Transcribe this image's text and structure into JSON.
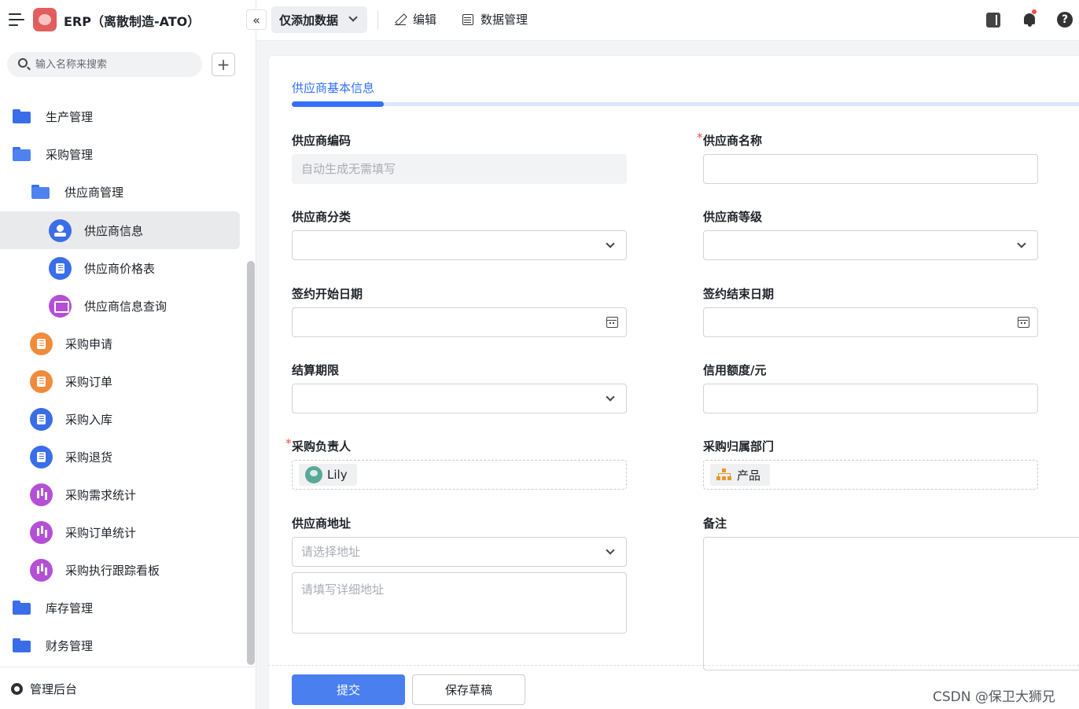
{
  "app": {
    "title": "ERP（离散制造-ATO）"
  },
  "search": {
    "placeholder": "输入名称来搜索"
  },
  "sidebar": {
    "items": [
      {
        "label": "生产管理",
        "icon": "folder-icon",
        "level": 0
      },
      {
        "label": "采购管理",
        "icon": "folder-open-icon",
        "level": 0
      },
      {
        "label": "供应商管理",
        "icon": "folder-open-icon",
        "level": 1
      },
      {
        "label": "供应商信息",
        "icon": "person-badge-icon",
        "color": "#3a6ee8",
        "level": 2,
        "active": true
      },
      {
        "label": "供应商价格表",
        "icon": "clipboard-icon",
        "color": "#3a6ee8",
        "level": 2
      },
      {
        "label": "供应商信息查询",
        "icon": "screen-chart-icon",
        "color": "#b44fd6",
        "level": 2
      },
      {
        "label": "采购申请",
        "icon": "document-icon",
        "color": "#f08b3c",
        "level": 1
      },
      {
        "label": "采购订单",
        "icon": "document-icon",
        "color": "#f08b3c",
        "level": 1
      },
      {
        "label": "采购入库",
        "icon": "document-icon",
        "color": "#3a6ee8",
        "level": 1
      },
      {
        "label": "采购退货",
        "icon": "document-icon",
        "color": "#3a6ee8",
        "level": 1
      },
      {
        "label": "采购需求统计",
        "icon": "bar-chart-icon",
        "color": "#b44fd6",
        "level": 1
      },
      {
        "label": "采购订单统计",
        "icon": "bar-chart-icon",
        "color": "#b44fd6",
        "level": 1
      },
      {
        "label": "采购执行跟踪看板",
        "icon": "bar-chart-icon",
        "color": "#b44fd6",
        "level": 1
      },
      {
        "label": "库存管理",
        "icon": "folder-icon",
        "level": 0
      },
      {
        "label": "财务管理",
        "icon": "folder-icon",
        "level": 0
      }
    ],
    "admin_label": "管理后台"
  },
  "toolbar": {
    "mode_label": "仅添加数据",
    "edit_label": "编辑",
    "data_manage_label": "数据管理"
  },
  "form": {
    "section_title": "供应商基本信息",
    "fields": {
      "supplier_code": {
        "label": "供应商编码",
        "placeholder": "自动生成无需填写"
      },
      "supplier_name": {
        "label": "供应商名称",
        "required_mark": "*"
      },
      "supplier_category": {
        "label": "供应商分类"
      },
      "supplier_level": {
        "label": "供应商等级"
      },
      "contract_start": {
        "label": "签约开始日期"
      },
      "contract_end": {
        "label": "签约结束日期"
      },
      "settlement_term": {
        "label": "结算期限"
      },
      "credit_limit": {
        "label": "信用额度/元"
      },
      "purchaser": {
        "label": "采购负责人",
        "required_mark": "*",
        "value": "Lily"
      },
      "department": {
        "label": "采购归属部门",
        "value": "产品"
      },
      "address": {
        "label": "供应商地址",
        "select_placeholder": "请选择地址",
        "detail_placeholder": "请填写详细地址"
      },
      "remark": {
        "label": "备注"
      }
    },
    "submit_label": "提交",
    "draft_label": "保存草稿"
  },
  "watermark": "CSDN @保卫大狮兄"
}
